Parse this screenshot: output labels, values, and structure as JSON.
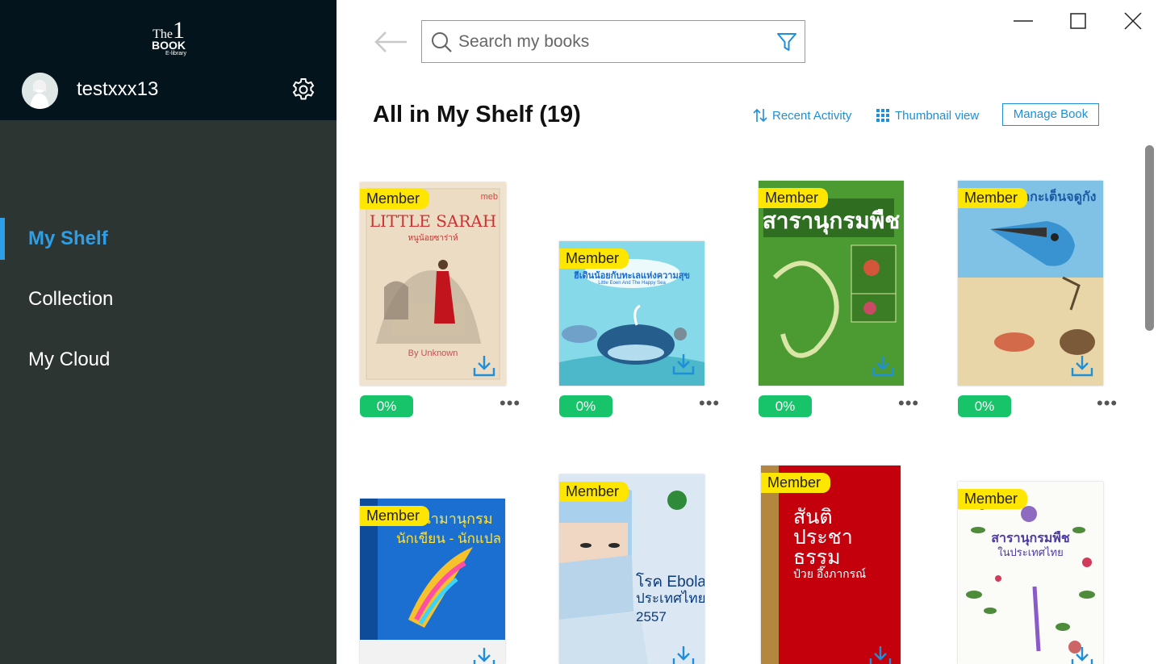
{
  "sidebar": {
    "logo": {
      "line1_a": "The",
      "line1_b": "1",
      "line2": "BOOK",
      "line3": "E-library"
    },
    "username": "testxxx13",
    "nav": [
      {
        "label": "My Shelf",
        "active": true
      },
      {
        "label": "Collection",
        "active": false
      },
      {
        "label": "My Cloud",
        "active": false
      }
    ]
  },
  "search": {
    "placeholder": "Search my books",
    "value": ""
  },
  "shelf": {
    "title": "All in My Shelf (19)",
    "sort_label": "Recent Activity",
    "view_label": "Thumbnail view",
    "manage_label": "Manage Book"
  },
  "books": [
    {
      "badge": "Member",
      "progress": "0%",
      "cover_title": "LITTLE SARAH",
      "cover_sub": "หนูน้อยซาร่าห์",
      "cover_author": "By Unknown",
      "cover_publisher": "meb"
    },
    {
      "badge": "Member",
      "progress": "0%",
      "cover_title": "ฮีเดินน้อยกับทะเลแห่งความสุข",
      "cover_sub": "Little Eoen And The Happy Sea"
    },
    {
      "badge": "Member",
      "progress": "0%",
      "cover_title": "สารานุกรมพืช"
    },
    {
      "badge": "Member",
      "progress": "0%",
      "cover_title": "นกกะเต็นจดูกัง"
    },
    {
      "badge": "Member",
      "progress": "",
      "cover_title": "นามานุกรม",
      "cover_sub": "นักเขียน - นักแปล"
    },
    {
      "badge": "Member",
      "progress": "",
      "cover_title": "โรค Ebola",
      "cover_sub": "ประเทศไทย 2557"
    },
    {
      "badge": "Member",
      "progress": "",
      "cover_title": "สันติ ประชา ธรรม",
      "cover_sub": "ป๋วย อึ๊งภากรณ์"
    },
    {
      "badge": "Member",
      "progress": "",
      "cover_title": "สารานุกรมพืช",
      "cover_sub": "ในประเทศไทย"
    }
  ],
  "colors": {
    "accent": "#2e9fe6",
    "progress": "#18c46a",
    "badge": "#ffe600",
    "sidebar": "#2d3533",
    "sidebar_header": "#03141c"
  }
}
